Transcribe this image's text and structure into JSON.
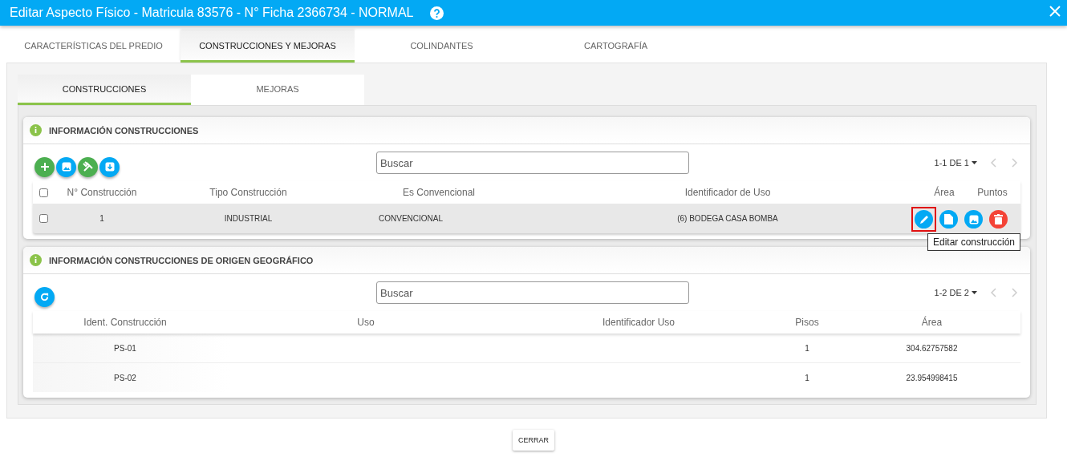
{
  "window": {
    "title": "Editar Aspecto Físico - Matricula 83576 - N° Ficha 2366734 - NORMAL"
  },
  "tabs": [
    {
      "label": "CARACTERÍSTICAS DEL PREDIO",
      "selected": false
    },
    {
      "label": "CONSTRUCCIONES Y MEJORAS",
      "selected": true
    },
    {
      "label": "COLINDANTES",
      "selected": false
    },
    {
      "label": "CARTOGRAFÍA",
      "selected": false
    }
  ],
  "subtabs": [
    {
      "label": "CONSTRUCCIONES",
      "selected": true
    },
    {
      "label": "MEJORAS",
      "selected": false
    }
  ],
  "sections": [
    {
      "title": "INFORMACIÓN CONSTRUCCIONES",
      "tools": [
        {
          "kind": "add"
        },
        {
          "kind": "image"
        },
        {
          "kind": "tools"
        },
        {
          "kind": "download"
        }
      ],
      "search": {
        "placeholder": "Buscar"
      },
      "pagination": "1-1 DE 1",
      "select_all": {
        "checked": false
      },
      "columns": [
        "N° Construcción",
        "Tipo Construcción",
        "Es Convencional",
        "Identificador de Uso",
        "Área",
        "Puntos"
      ],
      "rows": [
        {
          "checked": false,
          "cells": [
            "1",
            "INDUSTRIAL",
            "CONVENCIONAL",
            "(6) BODEGA CASA BOMBA"
          ],
          "actions": [
            {
              "kind": "edit",
              "highlighted": true,
              "tooltip": "Editar construcción"
            },
            {
              "kind": "document",
              "highlighted": false
            },
            {
              "kind": "image",
              "highlighted": false
            },
            {
              "kind": "delete",
              "highlighted": false
            }
          ]
        }
      ]
    },
    {
      "title": "INFORMACIÓN CONSTRUCCIONES DE ORIGEN GEOGRÁFICO",
      "tools": [
        {
          "kind": "refresh"
        }
      ],
      "search": {
        "placeholder": "Buscar"
      },
      "pagination": "1-2 DE 2",
      "columns": [
        "Ident. Construcción",
        "Uso",
        "Identificador Uso",
        "Pisos",
        "Área"
      ],
      "rows": [
        {
          "cells": [
            "PS-01",
            "",
            "",
            "1",
            "304.62757582"
          ]
        },
        {
          "cells": [
            "PS-02",
            "",
            "",
            "1",
            "23.954998415"
          ]
        }
      ]
    }
  ],
  "close_button": "CERRAR"
}
